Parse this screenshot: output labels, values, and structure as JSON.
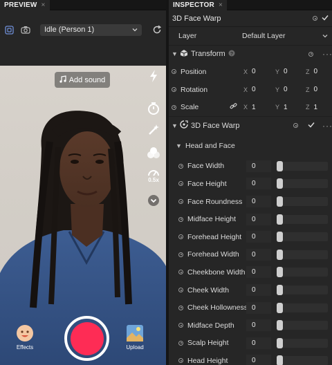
{
  "preview": {
    "tab_label": "PREVIEW",
    "tab_close": "×",
    "person_select": {
      "value": "Idle (Person 1)"
    },
    "add_sound_label": "Add sound",
    "zoom_label": "0.5x",
    "effects_label": "Effects",
    "upload_label": "Upload"
  },
  "inspector": {
    "tab_label": "INSPECTOR",
    "tab_close": "×",
    "object_title": "3D Face Warp",
    "layer": {
      "label": "Layer",
      "value": "Default Layer"
    },
    "transform": {
      "title": "Transform",
      "position": {
        "label": "Position",
        "x": "0",
        "y": "0",
        "z": "0"
      },
      "rotation": {
        "label": "Rotation",
        "x": "0",
        "y": "0",
        "z": "0"
      },
      "scale": {
        "label": "Scale",
        "x": "1",
        "y": "1",
        "z": "1"
      }
    },
    "axis": {
      "x": "X",
      "y": "Y",
      "z": "Z"
    },
    "face_warp": {
      "title": "3D Face Warp",
      "group_title": "Head and Face",
      "params": [
        {
          "label": "Face Width",
          "value": "0",
          "level": 0
        },
        {
          "label": "Face Height",
          "value": "0",
          "level": 0
        },
        {
          "label": "Face Roundness",
          "value": "0",
          "level": 0
        },
        {
          "label": "Midface Height",
          "value": "0",
          "level": 0
        },
        {
          "label": "Forehead Height",
          "value": "0",
          "level": 0
        },
        {
          "label": "Forehead Width",
          "value": "0",
          "level": 0
        },
        {
          "label": "Cheekbone Width",
          "value": "0",
          "level": 0
        },
        {
          "label": "Cheek Width",
          "value": "0",
          "level": 0
        },
        {
          "label": "Cheek Hollowness",
          "value": "0",
          "level": 0
        },
        {
          "label": "Midface Depth",
          "value": "0",
          "level": 0
        },
        {
          "label": "Scalp Height",
          "value": "0",
          "level": 0
        },
        {
          "label": "Head Height",
          "value": "0",
          "level": 0
        }
      ]
    }
  },
  "colors": {
    "record": "#fe2c55",
    "panel": "#262626",
    "tabbar": "#161616"
  }
}
